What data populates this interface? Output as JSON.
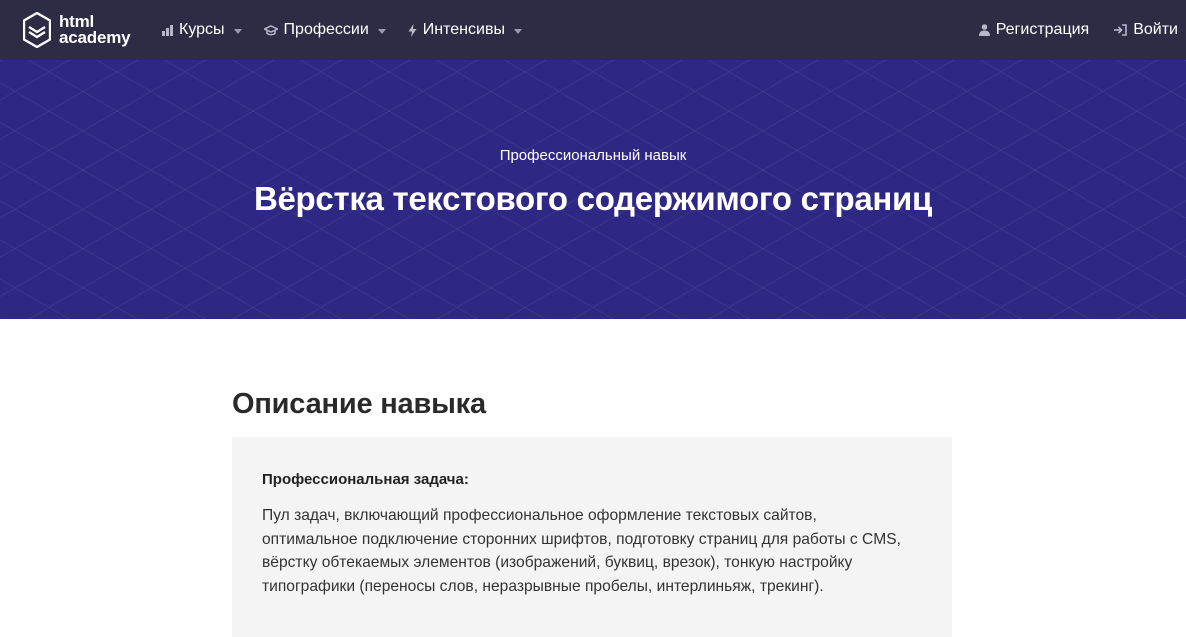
{
  "navbar": {
    "logo": {
      "line1": "html",
      "line2": "academy"
    },
    "left_items": [
      {
        "label": "Курсы",
        "icon": "bar-chart-icon"
      },
      {
        "label": "Профессии",
        "icon": "graduation-cap-icon"
      },
      {
        "label": "Интенсивы",
        "icon": "lightning-icon"
      }
    ],
    "right_items": [
      {
        "label": "Регистрация",
        "icon": "user-icon"
      },
      {
        "label": "Войти",
        "icon": "login-icon"
      }
    ]
  },
  "hero": {
    "subtitle": "Профессиональный навык",
    "title": "Вёрстка текстового содержимого страниц"
  },
  "section": {
    "title": "Описание навыка",
    "card": {
      "label": "Профессиональная задача:",
      "text": "Пул задач, включающий профессиональное оформление текстовых сайтов, оптимальное подключение сторонних шрифтов, подготовку страниц для работы с CMS, вёрстку обтекаемых элементов (изображений, буквиц, врезок), тонкую настройку типографики (переносы слов, неразрывные пробелы, интерлиньяж, трекинг)."
    }
  },
  "colors": {
    "navbar_bg": "#2c2c44",
    "hero_bg": "#2e2884",
    "card_bg": "#f4f4f4"
  }
}
